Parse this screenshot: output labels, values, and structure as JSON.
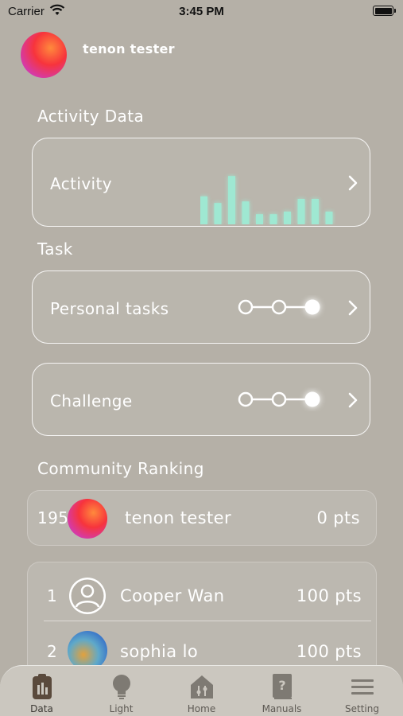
{
  "status_bar": {
    "carrier": "Carrier",
    "time": "3:45 PM"
  },
  "profile": {
    "name": "tenon tester"
  },
  "sections": {
    "activity_data": "Activity Data",
    "task": "Task",
    "community_ranking": "Community Ranking"
  },
  "cards": {
    "activity": "Activity",
    "personal_tasks": "Personal tasks",
    "challenge": "Challenge"
  },
  "activity_bars": [
    0.55,
    0.42,
    0.95,
    0.45,
    0.2,
    0.2,
    0.25,
    0.5,
    0.5,
    0.25
  ],
  "my_rank": {
    "rank": "195",
    "name": "tenon tester",
    "points": "0 pts"
  },
  "ranking": [
    {
      "rank": "1",
      "name": "Cooper Wan",
      "points": "100 pts"
    },
    {
      "rank": "2",
      "name": "sophia lo",
      "points": "100 pts"
    }
  ],
  "tabs": [
    {
      "label": "Data",
      "icon": "data-icon",
      "active": true
    },
    {
      "label": "Light",
      "icon": "bulb-icon",
      "active": false
    },
    {
      "label": "Home",
      "icon": "home-icon",
      "active": false
    },
    {
      "label": "Manuals",
      "icon": "manual-icon",
      "active": false
    },
    {
      "label": "Setting",
      "icon": "menu-icon",
      "active": false
    }
  ],
  "colors": {
    "background": "#b5b0a7",
    "bar_accent": "#9fe8d2",
    "tab_bar": "#cbc7bf"
  }
}
